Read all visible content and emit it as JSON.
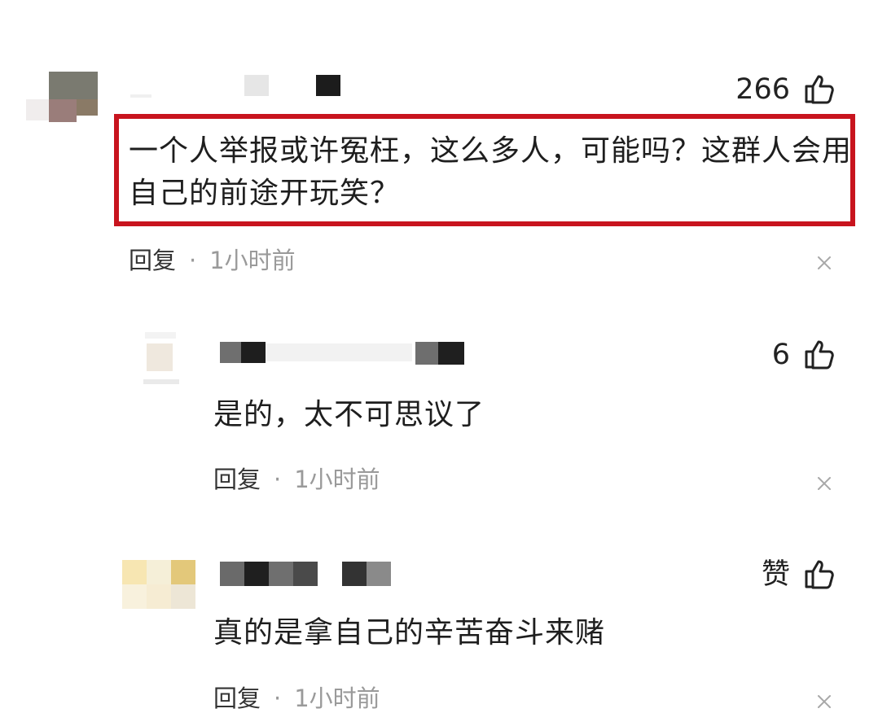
{
  "comments": [
    {
      "text_lines": [
        "一个人举报或许冤枉，这么多人，可能吗？这群人会用",
        "自己的前途开玩笑？"
      ],
      "likes": "266",
      "reply_label": "回复",
      "separator": "·",
      "time": "1小时前",
      "highlighted": true,
      "highlight_color": "#c8141e"
    },
    {
      "text_lines": [
        "是的，太不可思议了"
      ],
      "likes": "6",
      "reply_label": "回复",
      "separator": "·",
      "time": "1小时前"
    },
    {
      "text_lines": [
        "真的是拿自己的辛苦奋斗来赌"
      ],
      "likes": "赞",
      "reply_label": "回复",
      "separator": "·",
      "time": "1小时前"
    }
  ],
  "icons": {
    "like": "thumbs-up-icon",
    "close": "close-icon"
  }
}
